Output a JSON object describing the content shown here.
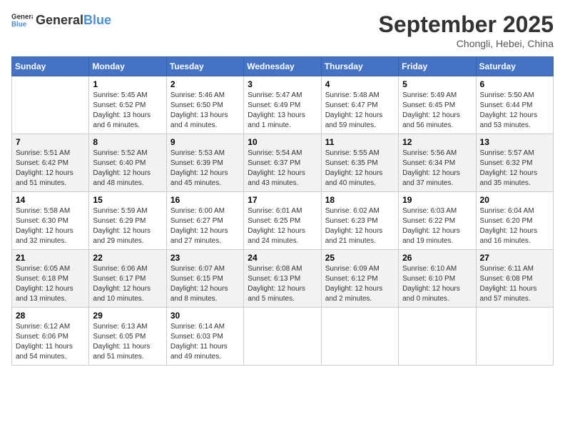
{
  "header": {
    "logo_general": "General",
    "logo_blue": "Blue",
    "month": "September 2025",
    "location": "Chongli, Hebei, China"
  },
  "weekdays": [
    "Sunday",
    "Monday",
    "Tuesday",
    "Wednesday",
    "Thursday",
    "Friday",
    "Saturday"
  ],
  "weeks": [
    [
      {
        "day": "",
        "sunrise": "",
        "sunset": "",
        "daylight": ""
      },
      {
        "day": "1",
        "sunrise": "Sunrise: 5:45 AM",
        "sunset": "Sunset: 6:52 PM",
        "daylight": "Daylight: 13 hours and 6 minutes."
      },
      {
        "day": "2",
        "sunrise": "Sunrise: 5:46 AM",
        "sunset": "Sunset: 6:50 PM",
        "daylight": "Daylight: 13 hours and 4 minutes."
      },
      {
        "day": "3",
        "sunrise": "Sunrise: 5:47 AM",
        "sunset": "Sunset: 6:49 PM",
        "daylight": "Daylight: 13 hours and 1 minute."
      },
      {
        "day": "4",
        "sunrise": "Sunrise: 5:48 AM",
        "sunset": "Sunset: 6:47 PM",
        "daylight": "Daylight: 12 hours and 59 minutes."
      },
      {
        "day": "5",
        "sunrise": "Sunrise: 5:49 AM",
        "sunset": "Sunset: 6:45 PM",
        "daylight": "Daylight: 12 hours and 56 minutes."
      },
      {
        "day": "6",
        "sunrise": "Sunrise: 5:50 AM",
        "sunset": "Sunset: 6:44 PM",
        "daylight": "Daylight: 12 hours and 53 minutes."
      }
    ],
    [
      {
        "day": "7",
        "sunrise": "Sunrise: 5:51 AM",
        "sunset": "Sunset: 6:42 PM",
        "daylight": "Daylight: 12 hours and 51 minutes."
      },
      {
        "day": "8",
        "sunrise": "Sunrise: 5:52 AM",
        "sunset": "Sunset: 6:40 PM",
        "daylight": "Daylight: 12 hours and 48 minutes."
      },
      {
        "day": "9",
        "sunrise": "Sunrise: 5:53 AM",
        "sunset": "Sunset: 6:39 PM",
        "daylight": "Daylight: 12 hours and 45 minutes."
      },
      {
        "day": "10",
        "sunrise": "Sunrise: 5:54 AM",
        "sunset": "Sunset: 6:37 PM",
        "daylight": "Daylight: 12 hours and 43 minutes."
      },
      {
        "day": "11",
        "sunrise": "Sunrise: 5:55 AM",
        "sunset": "Sunset: 6:35 PM",
        "daylight": "Daylight: 12 hours and 40 minutes."
      },
      {
        "day": "12",
        "sunrise": "Sunrise: 5:56 AM",
        "sunset": "Sunset: 6:34 PM",
        "daylight": "Daylight: 12 hours and 37 minutes."
      },
      {
        "day": "13",
        "sunrise": "Sunrise: 5:57 AM",
        "sunset": "Sunset: 6:32 PM",
        "daylight": "Daylight: 12 hours and 35 minutes."
      }
    ],
    [
      {
        "day": "14",
        "sunrise": "Sunrise: 5:58 AM",
        "sunset": "Sunset: 6:30 PM",
        "daylight": "Daylight: 12 hours and 32 minutes."
      },
      {
        "day": "15",
        "sunrise": "Sunrise: 5:59 AM",
        "sunset": "Sunset: 6:29 PM",
        "daylight": "Daylight: 12 hours and 29 minutes."
      },
      {
        "day": "16",
        "sunrise": "Sunrise: 6:00 AM",
        "sunset": "Sunset: 6:27 PM",
        "daylight": "Daylight: 12 hours and 27 minutes."
      },
      {
        "day": "17",
        "sunrise": "Sunrise: 6:01 AM",
        "sunset": "Sunset: 6:25 PM",
        "daylight": "Daylight: 12 hours and 24 minutes."
      },
      {
        "day": "18",
        "sunrise": "Sunrise: 6:02 AM",
        "sunset": "Sunset: 6:23 PM",
        "daylight": "Daylight: 12 hours and 21 minutes."
      },
      {
        "day": "19",
        "sunrise": "Sunrise: 6:03 AM",
        "sunset": "Sunset: 6:22 PM",
        "daylight": "Daylight: 12 hours and 19 minutes."
      },
      {
        "day": "20",
        "sunrise": "Sunrise: 6:04 AM",
        "sunset": "Sunset: 6:20 PM",
        "daylight": "Daylight: 12 hours and 16 minutes."
      }
    ],
    [
      {
        "day": "21",
        "sunrise": "Sunrise: 6:05 AM",
        "sunset": "Sunset: 6:18 PM",
        "daylight": "Daylight: 12 hours and 13 minutes."
      },
      {
        "day": "22",
        "sunrise": "Sunrise: 6:06 AM",
        "sunset": "Sunset: 6:17 PM",
        "daylight": "Daylight: 12 hours and 10 minutes."
      },
      {
        "day": "23",
        "sunrise": "Sunrise: 6:07 AM",
        "sunset": "Sunset: 6:15 PM",
        "daylight": "Daylight: 12 hours and 8 minutes."
      },
      {
        "day": "24",
        "sunrise": "Sunrise: 6:08 AM",
        "sunset": "Sunset: 6:13 PM",
        "daylight": "Daylight: 12 hours and 5 minutes."
      },
      {
        "day": "25",
        "sunrise": "Sunrise: 6:09 AM",
        "sunset": "Sunset: 6:12 PM",
        "daylight": "Daylight: 12 hours and 2 minutes."
      },
      {
        "day": "26",
        "sunrise": "Sunrise: 6:10 AM",
        "sunset": "Sunset: 6:10 PM",
        "daylight": "Daylight: 12 hours and 0 minutes."
      },
      {
        "day": "27",
        "sunrise": "Sunrise: 6:11 AM",
        "sunset": "Sunset: 6:08 PM",
        "daylight": "Daylight: 11 hours and 57 minutes."
      }
    ],
    [
      {
        "day": "28",
        "sunrise": "Sunrise: 6:12 AM",
        "sunset": "Sunset: 6:06 PM",
        "daylight": "Daylight: 11 hours and 54 minutes."
      },
      {
        "day": "29",
        "sunrise": "Sunrise: 6:13 AM",
        "sunset": "Sunset: 6:05 PM",
        "daylight": "Daylight: 11 hours and 51 minutes."
      },
      {
        "day": "30",
        "sunrise": "Sunrise: 6:14 AM",
        "sunset": "Sunset: 6:03 PM",
        "daylight": "Daylight: 11 hours and 49 minutes."
      },
      {
        "day": "",
        "sunrise": "",
        "sunset": "",
        "daylight": ""
      },
      {
        "day": "",
        "sunrise": "",
        "sunset": "",
        "daylight": ""
      },
      {
        "day": "",
        "sunrise": "",
        "sunset": "",
        "daylight": ""
      },
      {
        "day": "",
        "sunrise": "",
        "sunset": "",
        "daylight": ""
      }
    ]
  ]
}
